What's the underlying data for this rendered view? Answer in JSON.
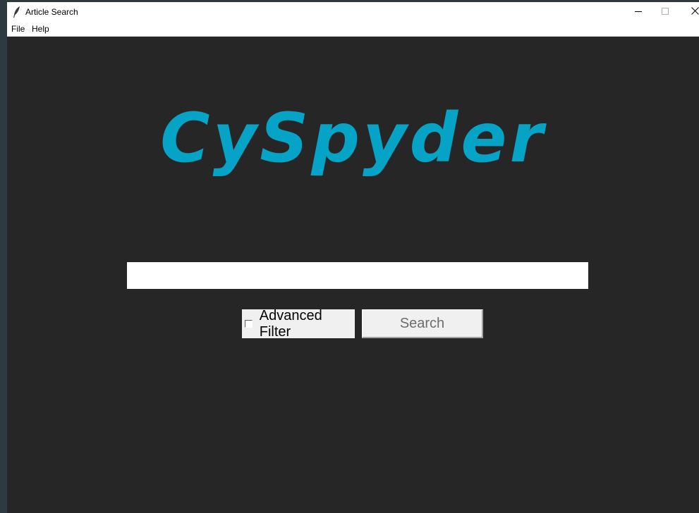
{
  "window": {
    "title": "Article Search",
    "controls": {
      "minimize_icon": "minimize-icon",
      "maximize_icon": "maximize-icon",
      "close_icon": "close-icon"
    }
  },
  "menu": {
    "items": [
      {
        "label": "File"
      },
      {
        "label": "Help"
      }
    ]
  },
  "main": {
    "logo_text": "CySpyder",
    "search_input": {
      "value": "",
      "placeholder": ""
    },
    "advanced_filter": {
      "label": "Advanced Filter",
      "checked": false
    },
    "search_button": {
      "label": "Search"
    }
  },
  "colors": {
    "background": "#262626",
    "logo": "#05a4c6",
    "button_face": "#f0f0f0",
    "button_text": "#6d6d6d"
  }
}
